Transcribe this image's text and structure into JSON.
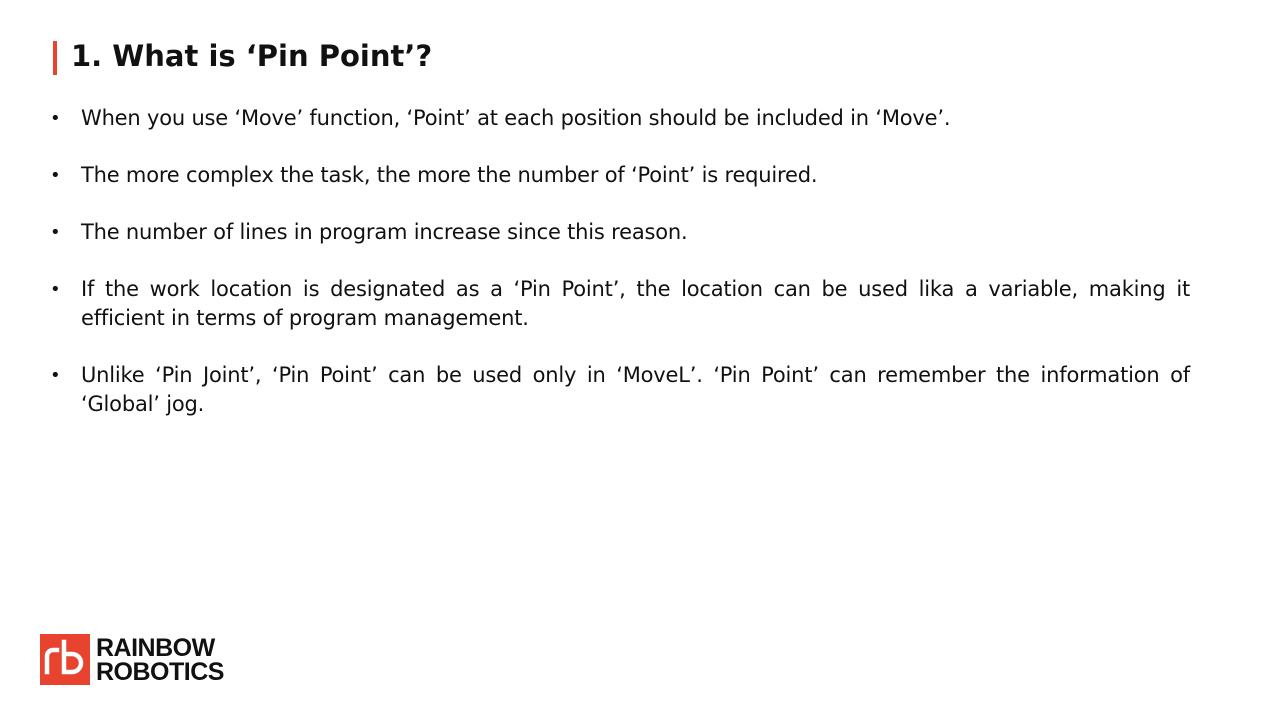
{
  "slide": {
    "title": "1. What is ‘Pin Point’?",
    "accent_color": "#e8432f",
    "bullet_glyph": "•",
    "bullets": [
      "When you use ‘Move’ function, ‘Point’ at each position should be included in ‘Move’.",
      "The more complex the task, the more the number of ‘Point’ is required.",
      "The number of lines in program increase since this reason.",
      "If the work location is designated as a ‘Pin Point’, the location can be used lika a variable, making it efficient in terms of program management.",
      "Unlike ‘Pin Joint’, ‘Pin Point’ can be used only in ‘MoveL’. ‘Pin Point’ can remember the information of ‘Global’ jog."
    ]
  },
  "logo": {
    "line1": "RAINBOW",
    "line2": "ROBOTICS",
    "icon": "rb-logo-icon"
  }
}
